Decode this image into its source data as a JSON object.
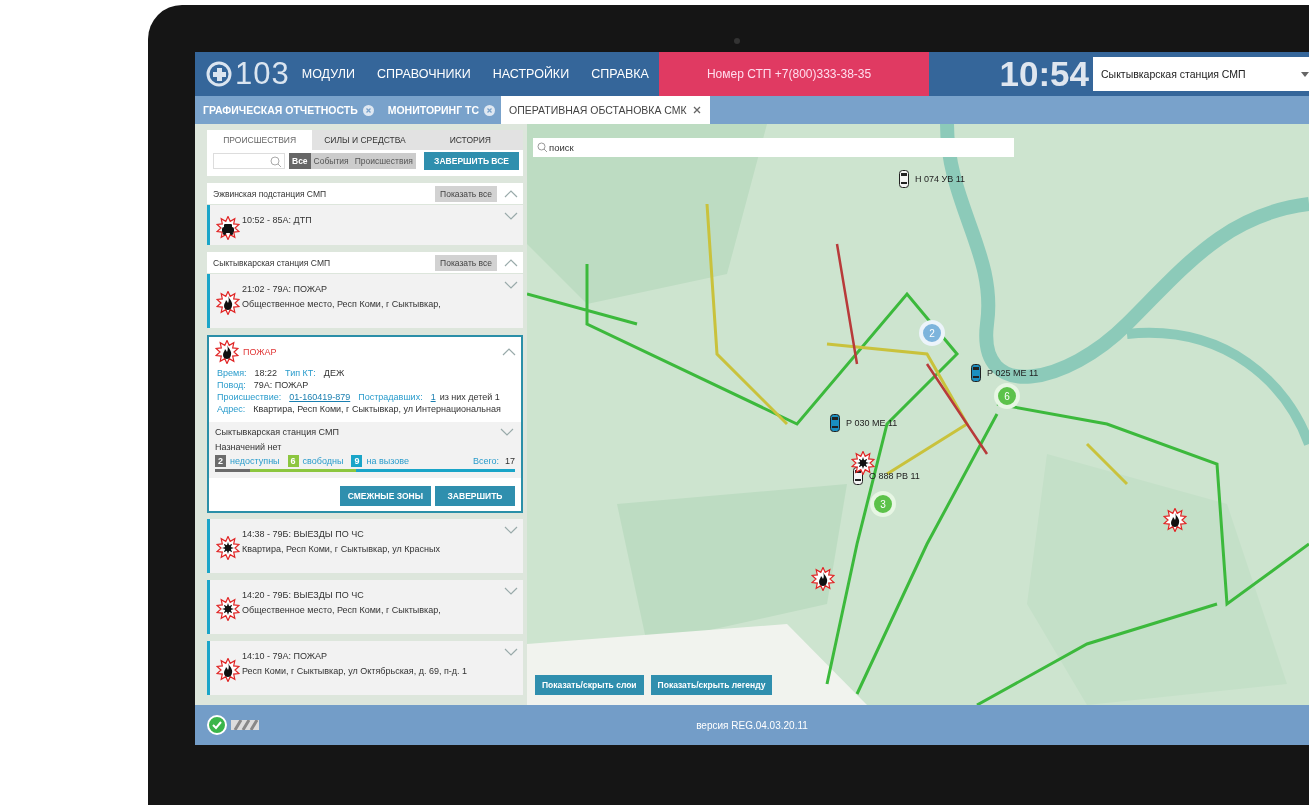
{
  "header": {
    "logo": "103",
    "menu": [
      {
        "label": "МОДУЛИ"
      },
      {
        "label": "СПРАВОЧНИКИ"
      },
      {
        "label": "НАСТРОЙКИ"
      },
      {
        "label": "СПРАВКА"
      }
    ],
    "phone": "Номер СТП +7(800)333-38-35",
    "time": "10:54",
    "station": "Сыктывкарская станция СМП"
  },
  "tabs": [
    {
      "label": "ГРАФИЧЕСКАЯ ОТЧЕТНОСТЬ",
      "selected": false
    },
    {
      "label": "МОНИТОРИНГ ТС",
      "selected": false
    },
    {
      "label": "ОПЕРАТИВНАЯ ОБСТАНОВКА СМК",
      "selected": true
    }
  ],
  "panel": {
    "tabs": [
      {
        "label": "ПРОИСШЕСТВИЯ",
        "selected": true
      },
      {
        "label": "СИЛЫ И СРЕДСТВА",
        "selected": false
      },
      {
        "label": "ИСТОРИЯ",
        "selected": false
      }
    ],
    "filters": [
      {
        "label": "Все",
        "selected": true
      },
      {
        "label": "События",
        "selected": false
      },
      {
        "label": "Происшествия",
        "selected": false
      }
    ],
    "finish_all": "ЗАВЕРШИТЬ ВСЕ",
    "groups": [
      {
        "name": "Эжвинская подстанция СМП",
        "show_all": "Показать все",
        "expanded": true,
        "incidents": [
          {
            "kind": "crash",
            "expanded": false,
            "title": "10:52 - 85А: ДТП"
          }
        ]
      },
      {
        "name": "Сыктывкарская станция СМП",
        "show_all": "Показать все",
        "expanded": true,
        "incidents": [
          {
            "kind": "fire",
            "expanded": false,
            "title": "21:02 - 79А: ПОЖАР",
            "address": "Общественное место, Респ Коми, г Сыктывкар,"
          },
          {
            "kind": "fire",
            "expanded": true,
            "title": "ПОЖАР",
            "fields": [
              [
                {
                  "label": "Время:",
                  "value": "18:22",
                  "link": false
                },
                {
                  "label": "Тип КТ:",
                  "value": "ДЕЖ",
                  "link": false
                }
              ],
              [
                {
                  "label": "Повод:",
                  "value": "79А: ПОЖАР",
                  "link": false
                }
              ],
              [
                {
                  "label": "Происшествие:",
                  "value": "01-160419-879",
                  "link": true
                },
                {
                  "label": "Пострадавших:",
                  "value": "1",
                  "link": true,
                  "note": "из них детей 1"
                }
              ],
              [
                {
                  "label": "Адрес:",
                  "value": "Квартира, Респ Коми, г Сыктывкар, ул Интернациональная",
                  "link": false
                }
              ]
            ],
            "station": {
              "name": "Сыктывкарская станция СМП",
              "assignments": "Назначений нет",
              "statuses": [
                {
                  "count": "2",
                  "label": "недоступны",
                  "color": "#6b6b6b"
                },
                {
                  "count": "6",
                  "label": "свободны",
                  "color": "#8cc63f"
                },
                {
                  "count": "9",
                  "label": "на вызове",
                  "color": "#1aa5c8"
                }
              ],
              "total_label": "Всего:",
              "total": "17"
            },
            "actions": [
              "СМЕЖНЫЕ ЗОНЫ",
              "ЗАВЕРШИТЬ"
            ]
          },
          {
            "kind": "emergency",
            "expanded": false,
            "title": "14:38 - 79Б: ВЫЕЗДЫ ПО ЧС",
            "address": "Квартира, Респ Коми, г Сыктывкар, ул Красных"
          },
          {
            "kind": "emergency",
            "expanded": false,
            "title": "14:20 - 79Б: ВЫЕЗДЫ ПО ЧС",
            "address": "Общественное место, Респ Коми, г Сыктывкар,"
          },
          {
            "kind": "fire",
            "expanded": false,
            "title": "14:10 - 79А: ПОЖАР",
            "address": "Респ Коми, г Сыктывкар, ул Октябрьская, д. 69, п-д. 1"
          }
        ]
      }
    ]
  },
  "map": {
    "search_placeholder": "поиск",
    "vehicles": [
      {
        "plate": "Н 074 УВ 11",
        "color": "#f4f4f4"
      },
      {
        "plate": "Р 025 МЕ 11",
        "color": "#1a8fc0"
      },
      {
        "plate": "Р 030 МЕ 11",
        "color": "#1a8fc0"
      },
      {
        "plate": "О 888 РВ 11",
        "color": "#f4f4f4"
      }
    ],
    "clusters": [
      {
        "count": "2",
        "color": "#7db4dc"
      },
      {
        "count": "6",
        "color": "#5cc24a"
      },
      {
        "count": "3",
        "color": "#5cc24a"
      }
    ],
    "markers": [
      {
        "kind": "emergency"
      },
      {
        "kind": "fire"
      },
      {
        "kind": "fire"
      }
    ],
    "buttons": [
      "Показать/скрыть слои",
      "Показать/скрыть легенду"
    ]
  },
  "footer": {
    "status_ok": true,
    "version": "версия REG.04.03.20.11"
  }
}
